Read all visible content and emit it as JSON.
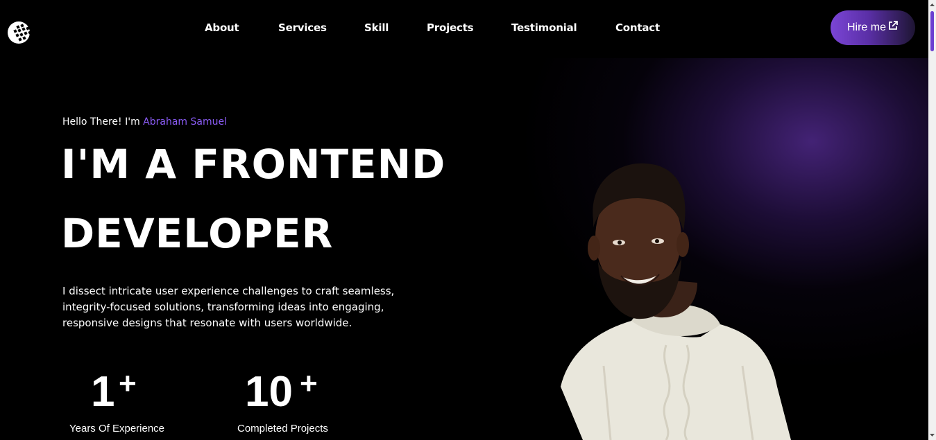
{
  "nav": {
    "items": [
      "About",
      "Services",
      "Skill",
      "Projects",
      "Testimonial",
      "Contact"
    ],
    "hire_label": "Hire me"
  },
  "hero": {
    "greeting_prefix": "Hello There! I'm",
    "greeting_name": "Abraham Samuel",
    "headline_line1": "I'M A FRONTEND",
    "headline_line2": "DEVELOPER",
    "description": "I dissect intricate user experience challenges to craft seamless, integrity-focused solutions, transforming ideas into engaging, responsive designs that resonate with users worldwide."
  },
  "stats": [
    {
      "value": "1",
      "suffix": "+",
      "label": "Years Of Experience"
    },
    {
      "value": "10",
      "suffix": "+",
      "label": "Completed Projects"
    }
  ],
  "colors": {
    "accent": "#8b5cf6",
    "hire_gradient_start": "#7b45d6",
    "background": "#000000"
  },
  "icons": {
    "logo": "globe-grid-logo-icon",
    "hire": "external-link-icon"
  }
}
